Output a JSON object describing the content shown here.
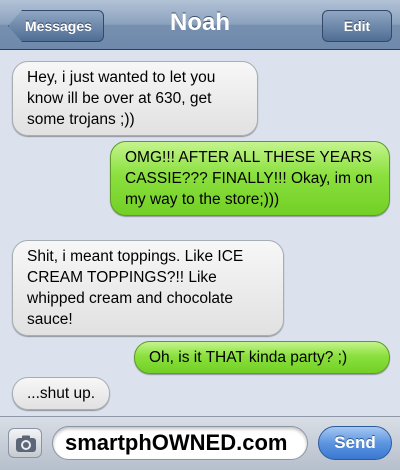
{
  "navbar": {
    "back_label": "Messages",
    "title": "Noah",
    "edit_label": "Edit"
  },
  "messages": [
    {
      "direction": "received",
      "text": "Hey, i just wanted to let you know ill be over at 630, get some trojans ;))"
    },
    {
      "direction": "sent",
      "text": "OMG!!! AFTER ALL THESE YEARS CASSIE??? FINALLY!!! Okay, im on my way to the store;)))"
    },
    {
      "direction": "received",
      "text": "Shit, i meant toppings. Like ICE CREAM TOPPINGS?!! Like whipped cream and chocolate sauce!"
    },
    {
      "direction": "sent",
      "text": "Oh, is it THAT kinda party? ;)"
    },
    {
      "direction": "received",
      "text": "...shut up."
    }
  ],
  "input_bar": {
    "camera_icon": "camera-icon",
    "field_text": "smartphOWNED.com",
    "send_label": "Send"
  },
  "colors": {
    "received_bubble": "#e8e8e8",
    "sent_bubble": "#8be03e",
    "navbar": "#7790b0",
    "send_button": "#3a78d1",
    "background": "#dbe2ed"
  }
}
